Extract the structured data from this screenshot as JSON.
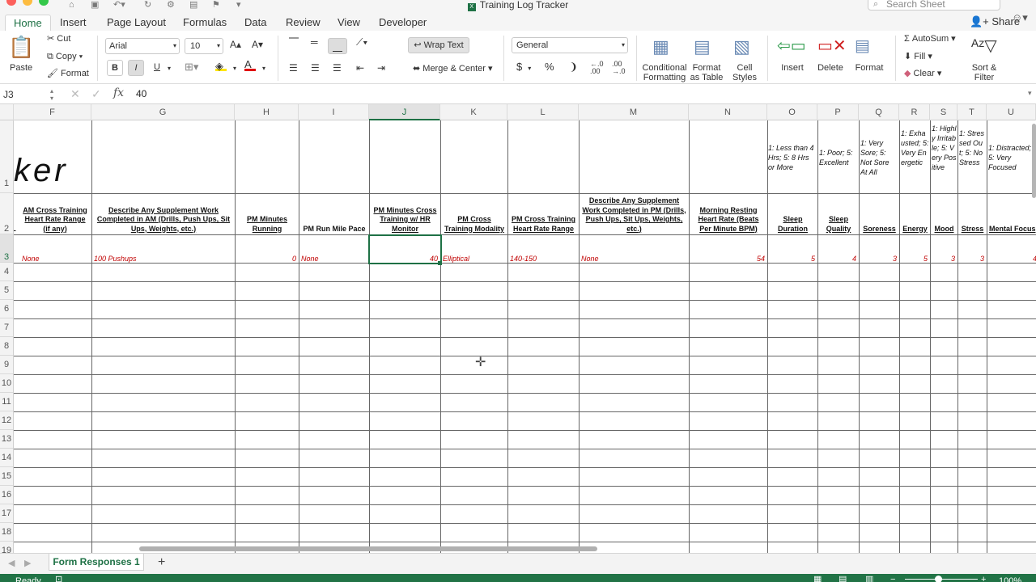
{
  "window": {
    "title": "Training Log Tracker",
    "search_placeholder": "Search Sheet"
  },
  "tabs": [
    {
      "label": "Home",
      "active": true
    },
    {
      "label": "Insert"
    },
    {
      "label": "Page Layout"
    },
    {
      "label": "Formulas"
    },
    {
      "label": "Data"
    },
    {
      "label": "Review"
    },
    {
      "label": "View"
    },
    {
      "label": "Developer"
    }
  ],
  "share_label": "Share",
  "ribbon": {
    "paste": "Paste",
    "cut": "Cut",
    "copy": "Copy",
    "format": "Format",
    "font_name": "Arial",
    "font_size": "10",
    "bold": "B",
    "italic": "I",
    "underline": "U",
    "wrap_text": "Wrap Text",
    "merge_center": "Merge & Center",
    "number_format": "General",
    "currency": "$",
    "percent": "%",
    "conditional_formatting": [
      "Conditional",
      "Formatting"
    ],
    "format_as_table": [
      "Format",
      "as Table"
    ],
    "cell_styles": [
      "Cell",
      "Styles"
    ],
    "insert": "Insert",
    "delete": "Delete",
    "format_cells": "Format",
    "autosum": "AutoSum",
    "fill": "Fill",
    "clear": "Clear",
    "sort_filter": [
      "Sort &",
      "Filter"
    ]
  },
  "formula_bar": {
    "name_box": "J3",
    "fx": "fx",
    "value": "40"
  },
  "columns": [
    "F",
    "G",
    "H",
    "I",
    "J",
    "K",
    "L",
    "M",
    "N",
    "O",
    "P",
    "Q",
    "R",
    "S",
    "T",
    "U"
  ],
  "selected_column": "J",
  "rows": [
    "1",
    "2",
    "3",
    "4",
    "5",
    "6",
    "7",
    "8",
    "9",
    "10",
    "11",
    "12",
    "13",
    "14",
    "15",
    "16",
    "17",
    "18",
    "19"
  ],
  "selected_row": "3",
  "sheet": {
    "title_fragment": "ker",
    "left_cut_header": "L",
    "headers": [
      "AM Cross Training Heart Rate Range (if any)",
      "Describe Any Supplement Work Completed in AM (Drills, Push Ups, Sit Ups, Weights, etc.)",
      "PM Minutes Running",
      "PM Run Mile Pace",
      "PM Minutes Cross Training w/ HR Monitor",
      "PM Cross Training Modality",
      "PM Cross Training Heart Rate Range",
      "Describe Any Supplement Work Completed in PM (Drills, Push Ups, Sit Ups, Weights, etc.)",
      "Morning Resting Heart Rate (Beats Per Minute BPM)",
      "Sleep Duration",
      "Sleep Quality",
      "Soreness",
      "Energy",
      "Mood",
      "Stress",
      "Mental Focus"
    ],
    "legends": [
      "1: Less than 4 Hrs; 5: 8 Hrs or More",
      "1: Poor; 5: Excellent",
      "1: Very Sore; 5: Not Sore At All",
      "1: Exhausted; 5: Very Energetic",
      "1: Highly Irritable; 5: Very Positive",
      "1: Stressed Out; 5: No Stress",
      "1: Distracted; 5: Very Focused"
    ],
    "row3": [
      "None",
      "100 Pushups",
      "0",
      "None",
      "40",
      "Elliptical",
      "140-150",
      "None",
      "54",
      "5",
      "4",
      "3",
      "5",
      "3",
      "3",
      "4"
    ]
  },
  "sheet_tab": "Form Responses 1",
  "status": {
    "ready": "Ready",
    "zoom": "100%"
  }
}
